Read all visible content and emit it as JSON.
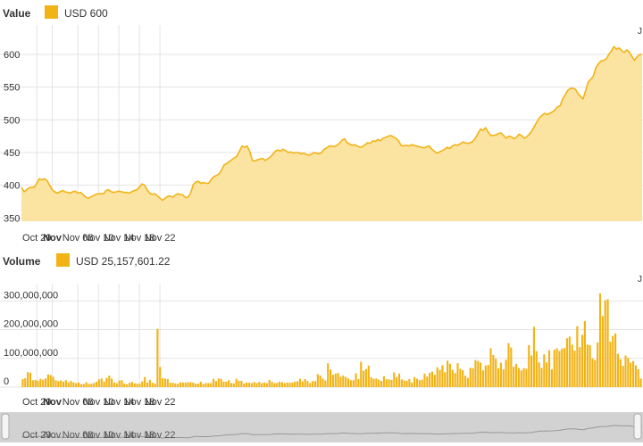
{
  "colors": {
    "accent": "#f2b316",
    "accent_fill": "#fbe4a2",
    "grid": "#e3e3e3",
    "navigator_bg": "#d2d2d2",
    "navigator_line": "#999999"
  },
  "header": {
    "price_title": "Value",
    "price_legend": "USD 600",
    "volume_title": "Volume",
    "volume_legend": "USD 25,157,601.22",
    "corner_mark": "J"
  },
  "chart_data": [
    {
      "type": "area",
      "title": "Value",
      "series": [
        {
          "name": "USD"
        }
      ],
      "x_start": "2020-10-26",
      "x_step_days": 0.5,
      "values": [
        397,
        390,
        393,
        396,
        397,
        397,
        403,
        410,
        408,
        410,
        407,
        400,
        393,
        390,
        388,
        390,
        392,
        390,
        389,
        388,
        390,
        391,
        388,
        389,
        386,
        382,
        380,
        382,
        384,
        386,
        387,
        387,
        387,
        392,
        393,
        390,
        389,
        390,
        391,
        390,
        389,
        389,
        388,
        390,
        392,
        393,
        397,
        402,
        400,
        393,
        388,
        386,
        387,
        384,
        380,
        377,
        380,
        383,
        383,
        382,
        385,
        387,
        386,
        385,
        381,
        382,
        388,
        401,
        405,
        406,
        403,
        404,
        403,
        403,
        409,
        413,
        415,
        417,
        423,
        431,
        433,
        436,
        439,
        442,
        444,
        452,
        460,
        458,
        460,
        452,
        438,
        437,
        439,
        440,
        441,
        438,
        440,
        443,
        447,
        452,
        454,
        452,
        455,
        453,
        450,
        451,
        449,
        450,
        450,
        448,
        449,
        447,
        446,
        447,
        450,
        449,
        448,
        450,
        455,
        457,
        460,
        460,
        459,
        461,
        464,
        469,
        471,
        465,
        463,
        461,
        462,
        460,
        458,
        459,
        462,
        465,
        464,
        468,
        467,
        470,
        468,
        472,
        473,
        475,
        476,
        474,
        472,
        468,
        461,
        460,
        461,
        460,
        462,
        461,
        460,
        459,
        458,
        457,
        459,
        460,
        455,
        452,
        449,
        451,
        453,
        455,
        458,
        456,
        460,
        462,
        461,
        463,
        466,
        465,
        464,
        465,
        467,
        472,
        479,
        486,
        484,
        488,
        481,
        476,
        476,
        477,
        479,
        480,
        476,
        472,
        475,
        474,
        471,
        473,
        478,
        476,
        472,
        474,
        478,
        483,
        490,
        497,
        503,
        507,
        510,
        508,
        510,
        512,
        515,
        520,
        521,
        532,
        538,
        545,
        548,
        548,
        547,
        540,
        536,
        532,
        545,
        558,
        562,
        567,
        580,
        586,
        590,
        591,
        593,
        600,
        605,
        612,
        608,
        610,
        606,
        603,
        607,
        604,
        597,
        591,
        596,
        600,
        600
      ],
      "ylim": [
        345,
        645
      ],
      "yticks": [
        350,
        400,
        450,
        500,
        550,
        600
      ],
      "xticks": [
        {
          "date": "2020-10-29",
          "label": "Oct 29",
          "bold": false
        },
        {
          "date": "2020-11-01",
          "label": "Nov",
          "bold": true
        },
        {
          "date": "2020-11-06",
          "label": "Nov 06",
          "bold": false
        },
        {
          "date": "2020-11-10",
          "label": "Nov 10",
          "bold": false
        },
        {
          "date": "2020-11-14",
          "label": "Nov 14",
          "bold": false
        },
        {
          "date": "2020-11-18",
          "label": "Nov 18",
          "bold": false
        },
        {
          "date": "2020-11-22",
          "label": "Nov 22",
          "bold": false
        }
      ],
      "grid": true
    },
    {
      "type": "bar",
      "title": "Volume",
      "series": [
        {
          "name": "USD"
        }
      ],
      "x_start": "2020-10-26",
      "x_step_days": 0.25,
      "values": [
        28000000,
        31000000,
        52000000,
        50000000,
        24000000,
        25000000,
        22000000,
        29000000,
        26000000,
        30000000,
        44000000,
        42000000,
        36000000,
        24000000,
        21000000,
        23000000,
        19000000,
        24000000,
        16000000,
        21000000,
        17000000,
        14000000,
        16000000,
        10000000,
        11000000,
        17000000,
        11000000,
        12000000,
        14000000,
        19000000,
        27000000,
        30000000,
        20000000,
        32000000,
        40000000,
        30000000,
        16000000,
        14000000,
        23000000,
        24000000,
        12000000,
        10000000,
        15000000,
        18000000,
        13000000,
        12000000,
        12000000,
        20000000,
        35000000,
        16000000,
        25000000,
        15000000,
        12000000,
        203000000,
        70000000,
        31000000,
        30000000,
        28000000,
        15000000,
        15000000,
        13000000,
        12000000,
        17000000,
        16000000,
        16000000,
        17000000,
        17000000,
        16000000,
        12000000,
        12000000,
        19000000,
        11000000,
        14000000,
        14000000,
        14000000,
        29000000,
        21000000,
        30000000,
        29000000,
        19000000,
        19000000,
        24000000,
        14000000,
        13000000,
        29000000,
        22000000,
        22000000,
        13000000,
        16000000,
        15000000,
        14000000,
        18000000,
        14000000,
        18000000,
        14000000,
        16000000,
        14000000,
        25000000,
        18000000,
        14000000,
        15000000,
        19000000,
        17000000,
        14000000,
        16000000,
        15000000,
        16000000,
        19000000,
        20000000,
        29000000,
        20000000,
        28000000,
        21000000,
        14000000,
        21000000,
        21000000,
        45000000,
        40000000,
        30000000,
        23000000,
        83000000,
        61000000,
        43000000,
        47000000,
        49000000,
        36000000,
        40000000,
        35000000,
        30000000,
        24000000,
        24000000,
        48000000,
        28000000,
        88000000,
        57000000,
        63000000,
        75000000,
        34000000,
        29000000,
        30000000,
        26000000,
        21000000,
        38000000,
        27000000,
        27000000,
        25000000,
        51000000,
        35000000,
        47000000,
        27000000,
        23000000,
        22000000,
        28000000,
        16000000,
        35000000,
        29000000,
        24000000,
        26000000,
        47000000,
        37000000,
        50000000,
        54000000,
        43000000,
        69000000,
        60000000,
        76000000,
        52000000,
        92000000,
        81000000,
        60000000,
        49000000,
        83000000,
        64000000,
        59000000,
        40000000,
        32000000,
        67000000,
        66000000,
        94000000,
        91000000,
        85000000,
        58000000,
        75000000,
        77000000,
        135000000,
        112000000,
        98000000,
        66000000,
        85000000,
        62000000,
        95000000,
        153000000,
        138000000,
        71000000,
        81000000,
        67000000,
        58000000,
        66000000,
        64000000,
        146000000,
        110000000,
        210000000,
        125000000,
        86000000,
        67000000,
        114000000,
        86000000,
        128000000,
        62000000,
        130000000,
        135000000,
        126000000,
        134000000,
        136000000,
        170000000,
        176000000,
        148000000,
        127000000,
        212000000,
        139000000,
        182000000,
        230000000,
        148000000,
        146000000,
        100000000,
        94000000,
        155000000,
        326000000,
        247000000,
        302000000,
        306000000,
        158000000,
        178000000,
        187000000,
        116000000,
        97000000,
        74000000,
        110000000,
        102000000,
        85000000,
        91000000,
        76000000,
        62000000,
        30000000
      ],
      "ylim": [
        0,
        360000000
      ],
      "yticks": [
        {
          "value": 0,
          "label": "0"
        },
        {
          "value": 100000000,
          "label": "100,000,000"
        },
        {
          "value": 200000000,
          "label": "200,000,000"
        },
        {
          "value": 300000000,
          "label": "300,000,000"
        }
      ],
      "xticks": [
        {
          "date": "2020-10-29",
          "label": "Oct 29",
          "bold": false
        },
        {
          "date": "2020-11-01",
          "label": "Nov",
          "bold": true
        },
        {
          "date": "2020-11-06",
          "label": "Nov 06",
          "bold": false
        },
        {
          "date": "2020-11-10",
          "label": "Nov 10",
          "bold": false
        },
        {
          "date": "2020-11-14",
          "label": "Nov 14",
          "bold": false
        },
        {
          "date": "2020-11-18",
          "label": "Nov 18",
          "bold": false
        },
        {
          "date": "2020-11-22",
          "label": "Nov 22",
          "bold": false
        }
      ],
      "grid": true
    }
  ],
  "navigator": {
    "labels": [
      "Oct 29",
      "Nov",
      "Nov 06",
      "Nov 10",
      "Nov 14",
      "Nov 18",
      "Nov 22"
    ]
  }
}
